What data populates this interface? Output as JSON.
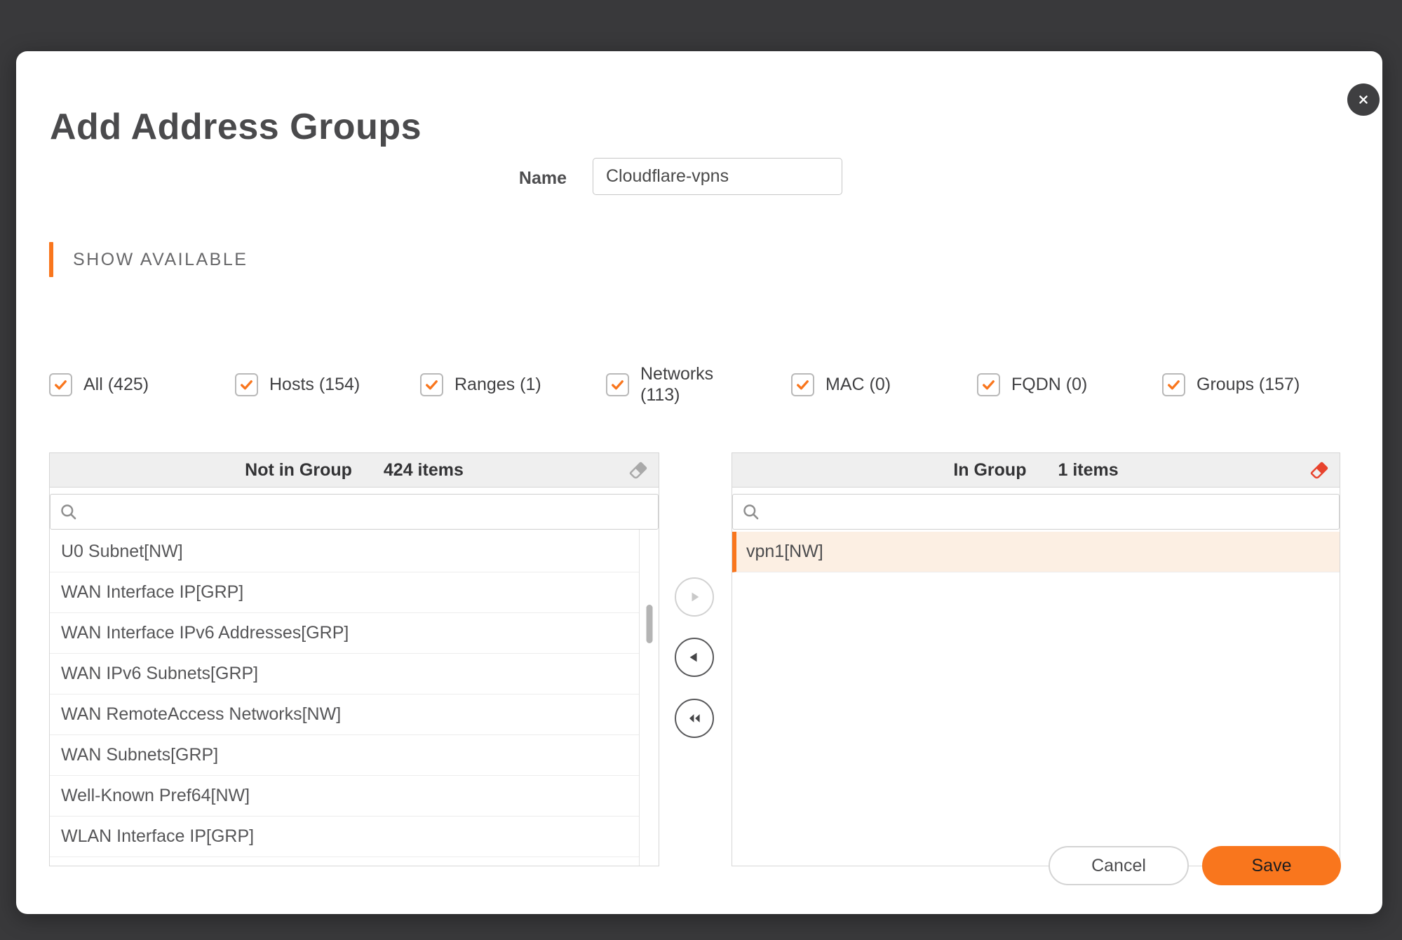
{
  "colors": {
    "accent": "#f9761d",
    "eraser_red": "#e8432d",
    "selected_row_bg": "#fcefe3"
  },
  "dialog": {
    "title": "Add Address Groups",
    "name_label": "Name",
    "name_value": "Cloudflare-vpns",
    "section_label": "SHOW AVAILABLE"
  },
  "icons": {
    "close": "x",
    "checkbox_check": "check",
    "search": "magnifier",
    "clear_list": "eraser",
    "move_right": "right-arrow",
    "move_left": "left-arrow",
    "move_all_left": "double-left-arrow"
  },
  "filters": [
    {
      "lines": [
        "All (425)"
      ],
      "checked": true
    },
    {
      "lines": [
        "Hosts (154)"
      ],
      "checked": true
    },
    {
      "lines": [
        "Ranges (1)"
      ],
      "checked": true
    },
    {
      "lines": [
        "Networks",
        "(113)"
      ],
      "checked": true
    },
    {
      "lines": [
        "MAC (0)"
      ],
      "checked": true
    },
    {
      "lines": [
        "FQDN (0)"
      ],
      "checked": true
    },
    {
      "lines": [
        "Groups (157)"
      ],
      "checked": true
    }
  ],
  "not_in_group": {
    "title": "Not in Group",
    "count": "424 items",
    "search_placeholder": "",
    "search_value": "",
    "items": [
      "U0 Subnet[NW]",
      "WAN Interface IP[GRP]",
      "WAN Interface IPv6 Addresses[GRP]",
      "WAN IPv6 Subnets[GRP]",
      "WAN RemoteAccess Networks[NW]",
      "WAN Subnets[GRP]",
      "Well-Known Pref64[NW]",
      "WLAN Interface IP[GRP]"
    ]
  },
  "in_group": {
    "title": "In Group",
    "count": "1 items",
    "search_placeholder": "",
    "search_value": "",
    "items": [
      "vpn1[NW]"
    ],
    "selected_index": 0
  },
  "actions": {
    "cancel": "Cancel",
    "save": "Save"
  }
}
